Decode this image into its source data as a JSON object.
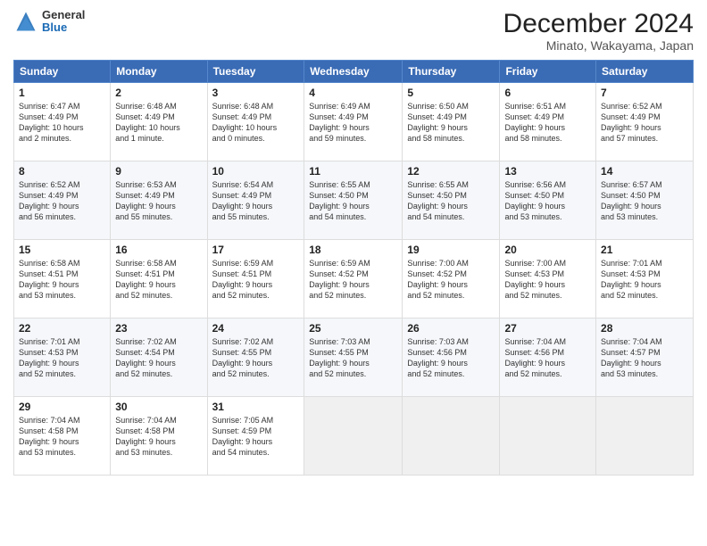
{
  "logo": {
    "general": "General",
    "blue": "Blue"
  },
  "header": {
    "title": "December 2024",
    "subtitle": "Minato, Wakayama, Japan"
  },
  "weekdays": [
    "Sunday",
    "Monday",
    "Tuesday",
    "Wednesday",
    "Thursday",
    "Friday",
    "Saturday"
  ],
  "weeks": [
    [
      {
        "day": "1",
        "info": "Sunrise: 6:47 AM\nSunset: 4:49 PM\nDaylight: 10 hours\nand 2 minutes."
      },
      {
        "day": "2",
        "info": "Sunrise: 6:48 AM\nSunset: 4:49 PM\nDaylight: 10 hours\nand 1 minute."
      },
      {
        "day": "3",
        "info": "Sunrise: 6:48 AM\nSunset: 4:49 PM\nDaylight: 10 hours\nand 0 minutes."
      },
      {
        "day": "4",
        "info": "Sunrise: 6:49 AM\nSunset: 4:49 PM\nDaylight: 9 hours\nand 59 minutes."
      },
      {
        "day": "5",
        "info": "Sunrise: 6:50 AM\nSunset: 4:49 PM\nDaylight: 9 hours\nand 58 minutes."
      },
      {
        "day": "6",
        "info": "Sunrise: 6:51 AM\nSunset: 4:49 PM\nDaylight: 9 hours\nand 58 minutes."
      },
      {
        "day": "7",
        "info": "Sunrise: 6:52 AM\nSunset: 4:49 PM\nDaylight: 9 hours\nand 57 minutes."
      }
    ],
    [
      {
        "day": "8",
        "info": "Sunrise: 6:52 AM\nSunset: 4:49 PM\nDaylight: 9 hours\nand 56 minutes."
      },
      {
        "day": "9",
        "info": "Sunrise: 6:53 AM\nSunset: 4:49 PM\nDaylight: 9 hours\nand 55 minutes."
      },
      {
        "day": "10",
        "info": "Sunrise: 6:54 AM\nSunset: 4:49 PM\nDaylight: 9 hours\nand 55 minutes."
      },
      {
        "day": "11",
        "info": "Sunrise: 6:55 AM\nSunset: 4:50 PM\nDaylight: 9 hours\nand 54 minutes."
      },
      {
        "day": "12",
        "info": "Sunrise: 6:55 AM\nSunset: 4:50 PM\nDaylight: 9 hours\nand 54 minutes."
      },
      {
        "day": "13",
        "info": "Sunrise: 6:56 AM\nSunset: 4:50 PM\nDaylight: 9 hours\nand 53 minutes."
      },
      {
        "day": "14",
        "info": "Sunrise: 6:57 AM\nSunset: 4:50 PM\nDaylight: 9 hours\nand 53 minutes."
      }
    ],
    [
      {
        "day": "15",
        "info": "Sunrise: 6:58 AM\nSunset: 4:51 PM\nDaylight: 9 hours\nand 53 minutes."
      },
      {
        "day": "16",
        "info": "Sunrise: 6:58 AM\nSunset: 4:51 PM\nDaylight: 9 hours\nand 52 minutes."
      },
      {
        "day": "17",
        "info": "Sunrise: 6:59 AM\nSunset: 4:51 PM\nDaylight: 9 hours\nand 52 minutes."
      },
      {
        "day": "18",
        "info": "Sunrise: 6:59 AM\nSunset: 4:52 PM\nDaylight: 9 hours\nand 52 minutes."
      },
      {
        "day": "19",
        "info": "Sunrise: 7:00 AM\nSunset: 4:52 PM\nDaylight: 9 hours\nand 52 minutes."
      },
      {
        "day": "20",
        "info": "Sunrise: 7:00 AM\nSunset: 4:53 PM\nDaylight: 9 hours\nand 52 minutes."
      },
      {
        "day": "21",
        "info": "Sunrise: 7:01 AM\nSunset: 4:53 PM\nDaylight: 9 hours\nand 52 minutes."
      }
    ],
    [
      {
        "day": "22",
        "info": "Sunrise: 7:01 AM\nSunset: 4:53 PM\nDaylight: 9 hours\nand 52 minutes."
      },
      {
        "day": "23",
        "info": "Sunrise: 7:02 AM\nSunset: 4:54 PM\nDaylight: 9 hours\nand 52 minutes."
      },
      {
        "day": "24",
        "info": "Sunrise: 7:02 AM\nSunset: 4:55 PM\nDaylight: 9 hours\nand 52 minutes."
      },
      {
        "day": "25",
        "info": "Sunrise: 7:03 AM\nSunset: 4:55 PM\nDaylight: 9 hours\nand 52 minutes."
      },
      {
        "day": "26",
        "info": "Sunrise: 7:03 AM\nSunset: 4:56 PM\nDaylight: 9 hours\nand 52 minutes."
      },
      {
        "day": "27",
        "info": "Sunrise: 7:04 AM\nSunset: 4:56 PM\nDaylight: 9 hours\nand 52 minutes."
      },
      {
        "day": "28",
        "info": "Sunrise: 7:04 AM\nSunset: 4:57 PM\nDaylight: 9 hours\nand 53 minutes."
      }
    ],
    [
      {
        "day": "29",
        "info": "Sunrise: 7:04 AM\nSunset: 4:58 PM\nDaylight: 9 hours\nand 53 minutes."
      },
      {
        "day": "30",
        "info": "Sunrise: 7:04 AM\nSunset: 4:58 PM\nDaylight: 9 hours\nand 53 minutes."
      },
      {
        "day": "31",
        "info": "Sunrise: 7:05 AM\nSunset: 4:59 PM\nDaylight: 9 hours\nand 54 minutes."
      },
      {
        "day": "",
        "info": ""
      },
      {
        "day": "",
        "info": ""
      },
      {
        "day": "",
        "info": ""
      },
      {
        "day": "",
        "info": ""
      }
    ]
  ]
}
